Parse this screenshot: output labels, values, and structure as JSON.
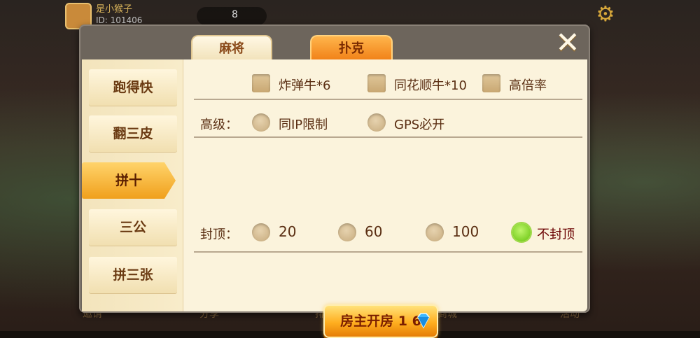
{
  "background": {
    "player_name": "是小猴子",
    "player_id": "ID: 101406",
    "coin_count": "8",
    "bottom_labels": [
      "邀请",
      "分享",
      "排行",
      "商城",
      "活动"
    ]
  },
  "tabs": [
    {
      "label": "麻将",
      "active": false
    },
    {
      "label": "扑克",
      "active": true
    }
  ],
  "close_icon": "close-icon",
  "sidebar": {
    "items": [
      {
        "label": "跑得快",
        "active": false
      },
      {
        "label": "翻三皮",
        "active": false
      },
      {
        "label": "拼十",
        "active": true
      },
      {
        "label": "三公",
        "active": false
      },
      {
        "label": "拼三张",
        "active": false
      }
    ]
  },
  "options": {
    "special": [
      {
        "label": "炸弹牛*6",
        "checked": false
      },
      {
        "label": "同花顺牛*10",
        "checked": false
      },
      {
        "label": "高倍率",
        "checked": false
      }
    ],
    "advanced_label": "高级：",
    "advanced": [
      {
        "label": "同IP限制",
        "selected": false
      },
      {
        "label": "GPS必开",
        "selected": false
      }
    ],
    "cap_label": "封顶：",
    "cap": [
      {
        "label": "20",
        "selected": false
      },
      {
        "label": "60",
        "selected": false
      },
      {
        "label": "100",
        "selected": false
      },
      {
        "label": "不封顶",
        "selected": true
      }
    ]
  },
  "create_button": {
    "label": "房主开房 1 6",
    "icon": "diamond-icon"
  },
  "colors": {
    "accent_orange": "#f07e14",
    "selected_green": "#64c20c",
    "panel_bg": "#fbf3dc",
    "text_brown": "#5a2e12"
  }
}
